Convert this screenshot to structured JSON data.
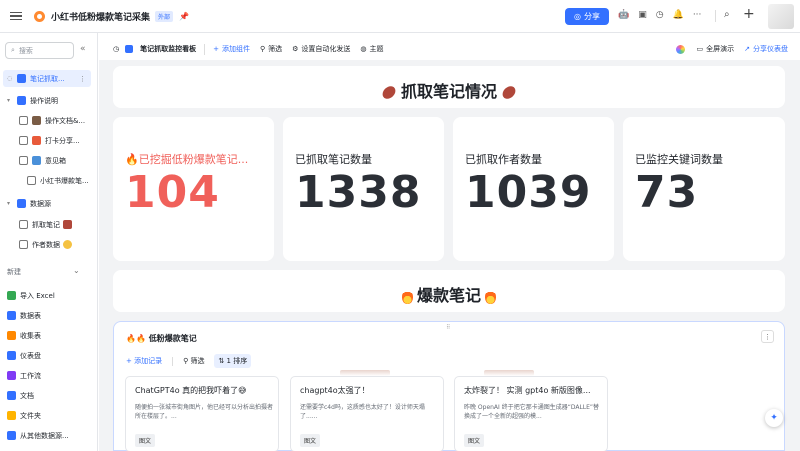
{
  "topbar": {
    "title": "小红书低粉爆款笔记采集",
    "badge": "外部",
    "share_label": "分享",
    "colors": {
      "primary": "#3370ff",
      "logo": "#ff8a30"
    }
  },
  "sidebar": {
    "search_placeholder": "搜索",
    "items": [
      {
        "label": "笔记抓取...",
        "icon": "dashboard-icon",
        "active": true
      },
      {
        "label": "操作说明",
        "icon": "number-one-icon"
      },
      {
        "label": "操作文档&...",
        "icon": "doc-icon"
      },
      {
        "label": "打卡分享...",
        "icon": "gift-icon"
      },
      {
        "label": "意见箱",
        "icon": "mailbox-icon"
      },
      {
        "label": "小红书爆款笔...",
        "icon": ""
      },
      {
        "label": "数据源",
        "icon": "number-two-icon"
      },
      {
        "label": "抓取笔记",
        "icon": "sweet-potato-icon"
      },
      {
        "label": "作者数据",
        "icon": "face-icon"
      }
    ],
    "section_label": "新建",
    "new_items": [
      {
        "label": "导入 Excel",
        "color": "#34a853"
      },
      {
        "label": "数据表",
        "color": "#3370ff"
      },
      {
        "label": "收集表",
        "color": "#ff8800"
      },
      {
        "label": "仪表盘",
        "color": "#3370ff"
      },
      {
        "label": "工作流",
        "color": "#7f3bf5"
      },
      {
        "label": "文档",
        "color": "#3370ff"
      },
      {
        "label": "文件夹",
        "color": "#ffb400"
      },
      {
        "label": "从其他数据源...",
        "color": "#3370ff"
      }
    ]
  },
  "subbar": {
    "dashboard_name": "笔记抓取监控看板",
    "add_component": "添加组件",
    "filter": "筛选",
    "automation": "设置自动化发送",
    "theme": "主题",
    "fullscreen": "全屏演示",
    "share_dashboard": "分享仪表盘"
  },
  "banner1": {
    "text": "抓取笔记情况"
  },
  "stats": [
    {
      "label": "🔥已挖掘低粉爆款笔记...",
      "value": "104",
      "color": "#f0605a"
    },
    {
      "label": "已抓取笔记数量",
      "value": "1338",
      "color": "#2b2f36"
    },
    {
      "label": "已抓取作者数量",
      "value": "1039",
      "color": "#2b2f36"
    },
    {
      "label": "已监控关键词数量",
      "value": "73",
      "color": "#2b2f36"
    }
  ],
  "banner2": {
    "text": "爆款笔记"
  },
  "table": {
    "title": "🔥🔥 低粉爆款笔记",
    "add_record": "添加记录",
    "filter": "筛选",
    "sort": "1 排序",
    "records": [
      {
        "title": "ChatGPT4o 真的把我吓着了😅",
        "body": "随便拍一张城市街角图片，他已经可以分析出拍摄者所在楼层了。...",
        "tag": "图文"
      },
      {
        "title": "chagpt4o太强了！",
        "body": "还需要学c4d吗，这质感也太好了！设计师天塌了......",
        "tag": "图文"
      },
      {
        "title": "太炸裂了！ 实测 gpt4o 新版图像...",
        "body": "昨晚 OpenAI 终于把它那卡通图生成器“DALLE”替换成了一个全新的超强的模...",
        "tag": "图文"
      }
    ]
  }
}
